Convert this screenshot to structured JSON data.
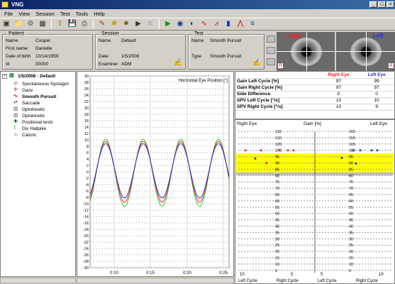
{
  "window": {
    "title": "VNG",
    "controls": [
      "_",
      "□",
      "×"
    ]
  },
  "menu": [
    "File",
    "View",
    "Session",
    "Test",
    "Tools",
    "Help"
  ],
  "toolbar": {
    "icons": [
      "window-icon",
      "folders-icon",
      "gears-icon",
      "table-icon",
      "export-icon",
      "save-icon",
      "print-icon",
      "pen-icon",
      "bulb-icon",
      "star-icon",
      "camera-icon",
      "dots-icon",
      "play-icon",
      "eye-icon",
      "record-icon",
      "wave-icon",
      "spike-icon",
      "bars-icon",
      "zigzag-icon",
      "stripes-icon"
    ],
    "glyphs": [
      "▣",
      "📁",
      "⚙",
      "▦",
      "⇪",
      "💾",
      "⎙",
      "✎",
      "✱",
      "✸",
      "▶",
      "⁙",
      "▶",
      "◉",
      "◐",
      "∿",
      "⩘",
      "▮",
      "⋀",
      "≡"
    ]
  },
  "patient": {
    "group": "Patient",
    "name_label": "Name",
    "name": "Cooper",
    "first_label": "First name",
    "first": "Danielle",
    "dob_label": "Date of birth",
    "dob": "10/14/1959",
    "id_label": "Id",
    "id": "00000"
  },
  "session": {
    "group": "Session",
    "name_label": "Name",
    "name": "Default",
    "date_label": "Date",
    "date": "1/5/2008",
    "examiner_label": "Examiner",
    "examiner": "ADM"
  },
  "test": {
    "group": "Test",
    "name_label": "Name",
    "name": "Smooth Pursuit",
    "type_label": "Type",
    "type": "Smooth Pursuit"
  },
  "cameras": {
    "right": "Right",
    "left": "Left",
    "r_mark": "R",
    "l_mark": "A"
  },
  "tree": {
    "root": "1/5/2008 : Default",
    "items": [
      "Spontaneous Nystagm",
      "Gaze",
      "Smooth Pursuit",
      "Saccade",
      "Optokinetic",
      "Optokinetic",
      "Positional tests",
      "Dix Hallpike",
      "Caloric"
    ],
    "selected": 2
  },
  "chart_data": {
    "type": "line",
    "title": "Horizontal Eye Position [°]",
    "ylim": [
      -30,
      30
    ],
    "yticks": [
      30,
      28,
      26,
      24,
      22,
      20,
      18,
      16,
      14,
      12,
      10,
      8,
      6,
      4,
      2,
      0,
      -2,
      -4,
      -6,
      -8,
      -10,
      -12,
      -14,
      -16,
      -18,
      -20,
      -22,
      -24,
      -26,
      -28,
      -30
    ],
    "xticks": [
      "0:10",
      "0:15",
      "0:20",
      "0:25"
    ],
    "series": [
      {
        "color": "#33cc33",
        "amplitude": 10.5
      },
      {
        "color": "#ff2222",
        "amplitude": 9.5
      },
      {
        "color": "#2233cc",
        "amplitude": 8.5
      }
    ]
  },
  "results": {
    "headers": [
      "",
      "Right Eye",
      "Left Eye"
    ],
    "rows": [
      [
        "Gain Left Cycle [%]",
        "97",
        "99"
      ],
      [
        "Gain Right Cycle [%]",
        "97",
        "97"
      ],
      [
        "Side Difference",
        "0",
        "0"
      ],
      [
        "SPV Left Cycle [°/s]",
        "10",
        "10"
      ],
      [
        "SPV Right Cycle [°/s]",
        "10",
        "9"
      ]
    ]
  },
  "gain_chart": {
    "right_label": "Right Eye",
    "gain_label": "Gain [%]",
    "left_label": "Left Eye",
    "scale": [
      "115",
      "110",
      "105",
      "100",
      "95",
      "90",
      "85",
      "80",
      "75",
      "70",
      "65",
      "60",
      "55",
      "50",
      "45",
      "40",
      "35",
      "30",
      "25",
      "20",
      "15",
      "10",
      "5"
    ],
    "x_ticks": [
      "10",
      "5",
      "5",
      "10"
    ],
    "x_labels": [
      "Left Cycle",
      "Right Cycle",
      "Left Cycle",
      "Right Cycle"
    ],
    "normal_band": "#ffff00"
  }
}
